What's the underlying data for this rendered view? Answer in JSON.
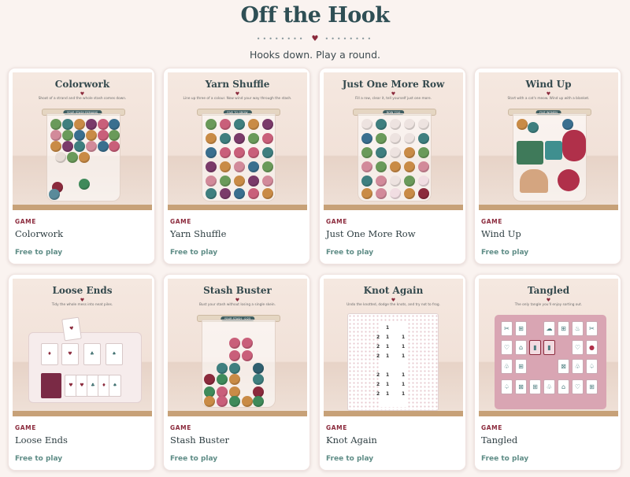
{
  "site": {
    "title": "Off the Hook",
    "divider_heart": "♥",
    "tagline": "Hooks down. Play a round."
  },
  "colors": {
    "accent": "#8b2a3c",
    "title": "#2f4f55",
    "free": "#5e8c86",
    "background": "#faf3f0"
  },
  "games": [
    {
      "label": "GAME",
      "name": "Colorwork",
      "price": "Free to play",
      "thumb_title": "Colorwork",
      "thumb_desc": "Shoot of a strand and the whole stash comes down.",
      "pill": "YOUR STASH REMAINS"
    },
    {
      "label": "GAME",
      "name": "Yarn Shuffle",
      "price": "Free to play",
      "thumb_title": "Yarn Shuffle",
      "thumb_desc": "Line up three of a colour. Now wind your way through the stash.",
      "pill": "FIVE TO GROW"
    },
    {
      "label": "GAME",
      "name": "Just One More Row",
      "price": "Free to play",
      "thumb_title": "Just One More Row",
      "thumb_desc": "Fill a row, clear it, tell yourself just one more.",
      "pill": "ROW 7/10"
    },
    {
      "label": "GAME",
      "name": "Wind Up",
      "price": "Free to play",
      "thumb_title": "Wind Up",
      "thumb_desc": "Start with a cat's meow. Wind up with a blanket.",
      "pill": "FIVE WOMEN"
    },
    {
      "label": "GAME",
      "name": "Loose Ends",
      "price": "Free to play",
      "thumb_title": "Loose Ends",
      "thumb_desc": "Tidy the whole mess into neat piles."
    },
    {
      "label": "GAME",
      "name": "Stash Buster",
      "price": "Free to play",
      "thumb_title": "Stash Buster",
      "thumb_desc": "Bust your stash without losing a single skein.",
      "pill": "YOUR STASH · 0/25"
    },
    {
      "label": "GAME",
      "name": "Knot Again",
      "price": "Free to play",
      "thumb_title": "Knot Again",
      "thumb_desc": "Undo the knotted, dodge the knots, and try not to frog."
    },
    {
      "label": "GAME",
      "name": "Tangled",
      "price": "Free to play",
      "thumb_title": "Tangled",
      "thumb_desc": "The only tangle you'll enjoy sorting out."
    }
  ]
}
